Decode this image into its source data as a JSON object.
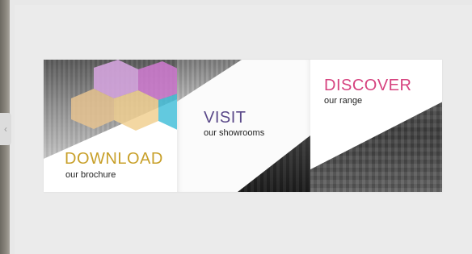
{
  "banner": {
    "panels": [
      {
        "id": "download",
        "title": "DOWNLOAD",
        "subtitle": "our brochure",
        "title_color": "#c8a02a"
      },
      {
        "id": "visit",
        "title": "VISIT",
        "subtitle": "our showrooms",
        "title_color": "#5b4a8a"
      },
      {
        "id": "discover",
        "title": "DISCOVER",
        "subtitle": "our range",
        "title_color": "#d6437f"
      }
    ]
  },
  "navigation": {
    "back_icon": "chevron-left-icon"
  }
}
